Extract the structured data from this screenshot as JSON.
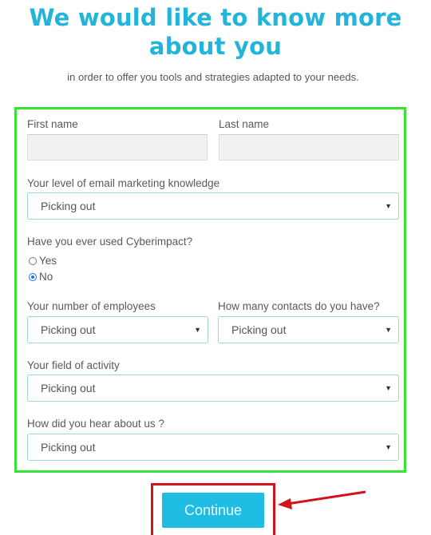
{
  "header": {
    "title_line1": "We would like to know more",
    "title_line2": "about you",
    "subtitle": "in order to offer you tools and strategies adapted to your needs."
  },
  "form": {
    "first_name": {
      "label": "First name",
      "value": ""
    },
    "last_name": {
      "label": "Last name",
      "value": ""
    },
    "email_knowledge": {
      "label": "Your level of email marketing knowledge",
      "selected": "Picking out"
    },
    "used_cyberimpact": {
      "label": "Have you ever used Cyberimpact?",
      "options": [
        {
          "label": "Yes",
          "checked": false
        },
        {
          "label": "No",
          "checked": true
        }
      ]
    },
    "employees": {
      "label": "Your number of employees",
      "selected": "Picking out"
    },
    "contacts": {
      "label": "How many contacts do you have?",
      "selected": "Picking out"
    },
    "field_of_activity": {
      "label": "Your field of activity",
      "selected": "Picking out"
    },
    "heard_about": {
      "label": "How did you hear about us ?",
      "selected": "Picking out"
    },
    "caret_glyph": "▼"
  },
  "actions": {
    "continue_label": "Continue"
  },
  "annotations": {
    "form_highlight_color": "#36e436",
    "button_highlight_color": "#d0141c",
    "arrow_color": "#d0141c"
  },
  "colors": {
    "accent": "#22b5d9",
    "button": "#1fbde3"
  }
}
